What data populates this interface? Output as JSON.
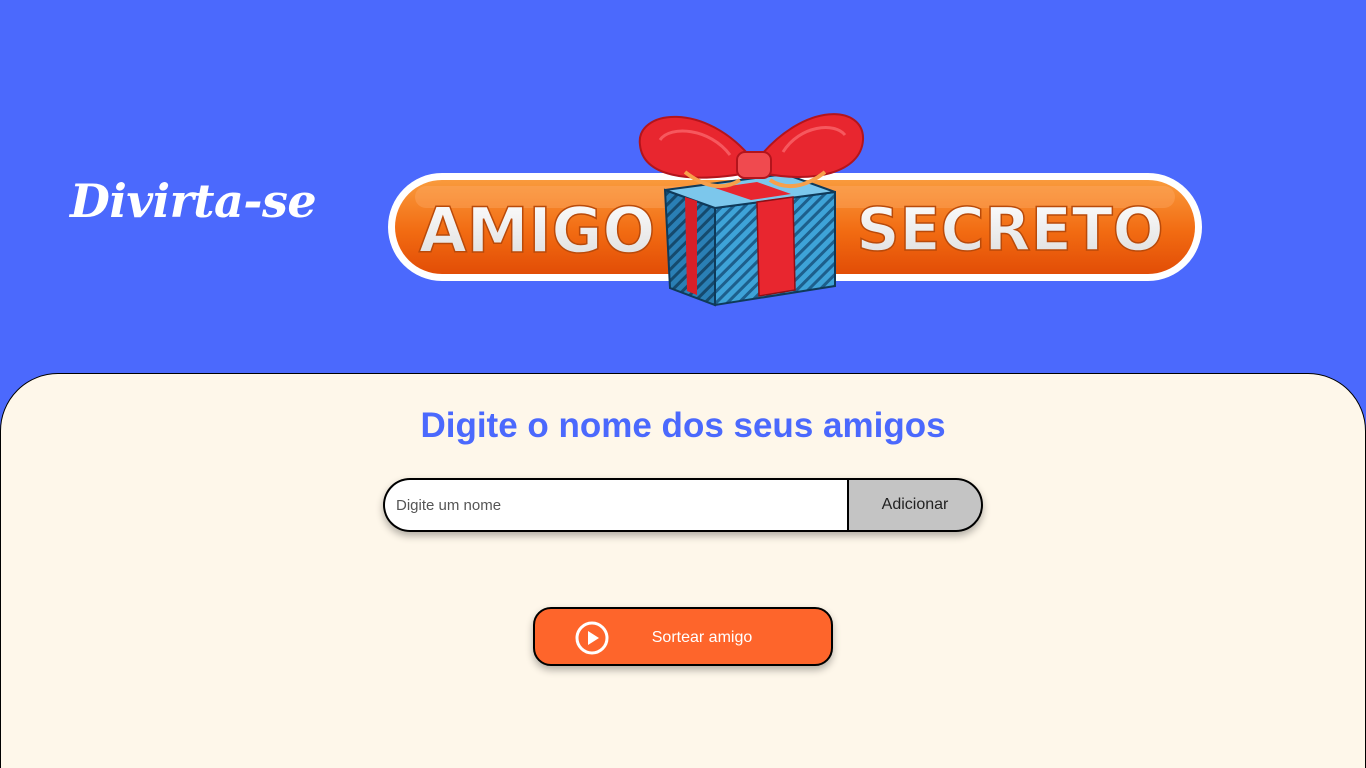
{
  "header": {
    "tagline": "Divirta-se",
    "logo": {
      "word_left": "AMIGO",
      "word_right": "SECRETO",
      "pill_color": "#f26b12",
      "ribbon_color": "#e8262f",
      "box_color": "#2f8fc4"
    }
  },
  "main": {
    "title": "Digite o nome dos seus amigos",
    "name_input": {
      "placeholder": "Digite um nome",
      "value": ""
    },
    "add_button_label": "Adicionar",
    "draw_button": {
      "label": "Sortear amigo",
      "icon": "play-circle-icon"
    }
  },
  "colors": {
    "background": "#4b69fd",
    "panel": "#fef7ea",
    "title": "#4b69fd",
    "draw_button": "#fe652b",
    "add_button": "#c4c4c4"
  }
}
